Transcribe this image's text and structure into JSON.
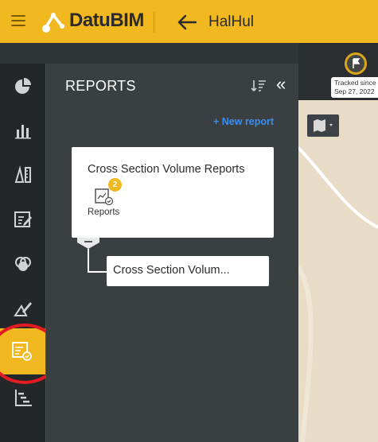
{
  "header": {
    "logo_text": "DatuBIM",
    "project_name": "HalHul"
  },
  "map": {
    "tracked_label_line1": "Tracked since",
    "tracked_label_line2": "Sep 27, 2022"
  },
  "rail": {
    "items": [
      {
        "icon": "pie-chart-icon"
      },
      {
        "icon": "bar-chart-icon"
      },
      {
        "icon": "measure-icon"
      },
      {
        "icon": "edit-note-icon"
      },
      {
        "icon": "layers-circles-icon"
      },
      {
        "icon": "annotate-icon"
      },
      {
        "icon": "reports-icon",
        "active": true
      },
      {
        "icon": "gantt-icon"
      }
    ],
    "accent": "#f2b820",
    "highlight": "#e31b23"
  },
  "panel": {
    "title": "REPORTS",
    "new_report_label": "+ New report",
    "card": {
      "title": "Cross Section Volume Reports",
      "badge_count": "2",
      "sub_label": "Reports"
    },
    "child": {
      "title": "Cross Section Volum..."
    }
  }
}
